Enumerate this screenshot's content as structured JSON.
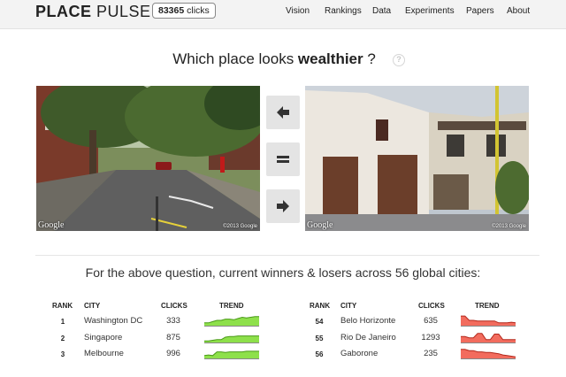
{
  "header": {
    "logo_bold": "PLACE",
    "logo_light": " PULSE",
    "clicks_count": "83365",
    "clicks_label": " clicks",
    "nav": [
      "Vision",
      "Rankings",
      "Data",
      "Experiments",
      "Papers",
      "About"
    ]
  },
  "question": {
    "prefix": "Which place looks ",
    "attribute": "wealthier",
    "suffix": " ?",
    "help": "?"
  },
  "images": {
    "google_label": "Google",
    "copyright": "©2013 Google"
  },
  "vote": {
    "left_icon": "arrow-left-icon",
    "equal_icon": "equal-icon",
    "right_icon": "arrow-right-icon"
  },
  "summary": "For the above question, current winners & losers across 56 global cities:",
  "table_headers": {
    "rank": "RANK",
    "city": "CITY",
    "clicks": "CLICKS",
    "trend": "TREND"
  },
  "winners": [
    {
      "rank": "1",
      "city": "Washington DC",
      "clicks": "333",
      "trend": [
        0.3,
        0.3,
        0.4,
        0.5,
        0.5,
        0.6,
        0.6,
        0.55,
        0.65,
        0.75,
        0.7,
        0.75,
        0.8,
        0.8
      ]
    },
    {
      "rank": "2",
      "city": "Singapore",
      "clicks": "875",
      "trend": [
        0.2,
        0.2,
        0.25,
        0.3,
        0.3,
        0.5,
        0.55,
        0.55,
        0.6,
        0.6,
        0.6,
        0.6,
        0.6,
        0.6
      ]
    },
    {
      "rank": "3",
      "city": "Melbourne",
      "clicks": "996",
      "trend": [
        0.3,
        0.35,
        0.3,
        0.6,
        0.6,
        0.55,
        0.6,
        0.6,
        0.6,
        0.6,
        0.65,
        0.65,
        0.65,
        0.65
      ]
    }
  ],
  "losers": [
    {
      "rank": "54",
      "city": "Belo Horizonte",
      "clicks": "635",
      "trend": [
        0.85,
        0.85,
        0.5,
        0.5,
        0.45,
        0.45,
        0.45,
        0.45,
        0.45,
        0.3,
        0.3,
        0.3,
        0.35,
        0.3
      ]
    },
    {
      "rank": "55",
      "city": "Rio De Janeiro",
      "clicks": "1293",
      "trend": [
        0.55,
        0.55,
        0.45,
        0.45,
        0.8,
        0.8,
        0.3,
        0.3,
        0.75,
        0.75,
        0.3,
        0.3,
        0.3,
        0.3
      ]
    },
    {
      "rank": "56",
      "city": "Gaborone",
      "clicks": "235",
      "trend": [
        0.8,
        0.8,
        0.7,
        0.7,
        0.6,
        0.6,
        0.55,
        0.55,
        0.5,
        0.45,
        0.35,
        0.3,
        0.25,
        0.2
      ]
    }
  ],
  "colors": {
    "winner_fill": "#8ee04b",
    "winner_line": "#4a9a18",
    "loser_fill": "#f26c5e",
    "loser_line": "#b3281c"
  }
}
